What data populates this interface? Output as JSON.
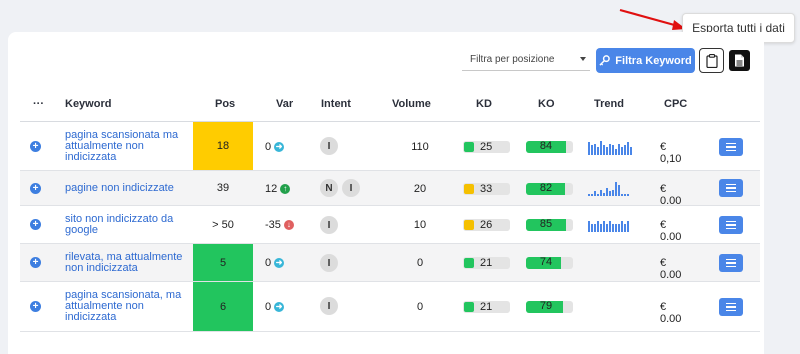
{
  "tooltip": {
    "text": "Esporta tutti i dati"
  },
  "toolbar": {
    "filter_placeholder": "Filtra per posizione",
    "filter_keyword_label": "Filtra Keyword"
  },
  "columns": {
    "dots": "···",
    "keyword": "Keyword",
    "pos": "Pos",
    "var": "Var",
    "intent": "Intent",
    "volume": "Volume",
    "kd": "KD",
    "ko": "KO",
    "trend": "Trend",
    "cpc": "CPC"
  },
  "rows": [
    {
      "keyword": "pagina scansionata ma attualmente non indicizzata",
      "pos": "18",
      "pos_color": "#ffcc00",
      "var": "0",
      "var_dir": "right",
      "intent": [
        "I"
      ],
      "volume": "110",
      "kd": "25",
      "kd_color": "#22c55e",
      "ko": "84",
      "ko_fill": 0.84,
      "trend": [
        0.8,
        0.6,
        0.7,
        0.5,
        0.9,
        0.6,
        0.5,
        0.7,
        0.6,
        0.4,
        0.7,
        0.5,
        0.6,
        0.8,
        0.5
      ],
      "cpc": "€ 0,10"
    },
    {
      "keyword": "pagine non indicizzate",
      "pos": "39",
      "pos_color": "",
      "var": "12",
      "var_dir": "up",
      "intent": [
        "N",
        "I"
      ],
      "volume": "20",
      "kd": "33",
      "kd_color": "#f5c000",
      "ko": "82",
      "ko_fill": 0.82,
      "trend": [
        0.1,
        0.1,
        0.3,
        0.1,
        0.4,
        0.2,
        0.5,
        0.3,
        0.4,
        0.9,
        0.7,
        0.1,
        0.1,
        0.1
      ],
      "cpc": "€ 0.00"
    },
    {
      "keyword": "sito non indicizzato da google",
      "pos": "> 50",
      "pos_color": "",
      "var": "-35",
      "var_dir": "down",
      "intent": [
        "I"
      ],
      "volume": "10",
      "kd": "26",
      "kd_color": "#f5c000",
      "ko": "85",
      "ko_fill": 0.85,
      "trend": [
        0.7,
        0.5,
        0.5,
        0.7,
        0.5,
        0.7,
        0.5,
        0.7,
        0.5,
        0.5,
        0.5,
        0.7,
        0.5,
        0.7
      ],
      "cpc": "€ 0.00"
    },
    {
      "keyword": "rilevata, ma attualmente non indicizzata",
      "pos": "5",
      "pos_color": "#22c55e",
      "var": "0",
      "var_dir": "right",
      "intent": [
        "I"
      ],
      "volume": "0",
      "kd": "21",
      "kd_color": "#22c55e",
      "ko": "74",
      "ko_fill": 0.74,
      "trend": [],
      "cpc": "€ 0.00"
    },
    {
      "keyword": "pagina scansionata, ma attualmente non indicizzata",
      "pos": "6",
      "pos_color": "#22c55e",
      "var": "0",
      "var_dir": "right",
      "intent": [
        "I"
      ],
      "volume": "0",
      "kd": "21",
      "kd_color": "#22c55e",
      "ko": "79",
      "ko_fill": 0.79,
      "trend": [],
      "cpc": "€ 0.00"
    }
  ]
}
